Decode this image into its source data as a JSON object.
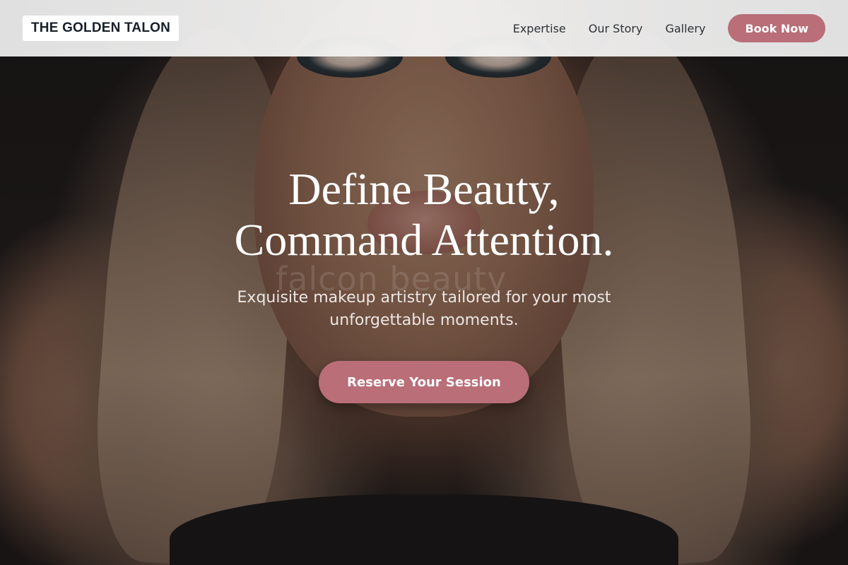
{
  "nav": {
    "logo": "THE GOLDEN TALON",
    "links": [
      "Expertise",
      "Our Story",
      "Gallery"
    ],
    "book_label": "Book Now"
  },
  "hero": {
    "headline_line1": "Define Beauty,",
    "headline_line2": "Command Attention.",
    "subtitle": "Exquisite makeup artistry tailored for your most unforgettable moments.",
    "cta_label": "Reserve Your Session",
    "watermark": "falcon beauty"
  },
  "colors": {
    "accent": "#b96e78",
    "logo_text": "#17202a",
    "nav_text": "#2d3136"
  }
}
